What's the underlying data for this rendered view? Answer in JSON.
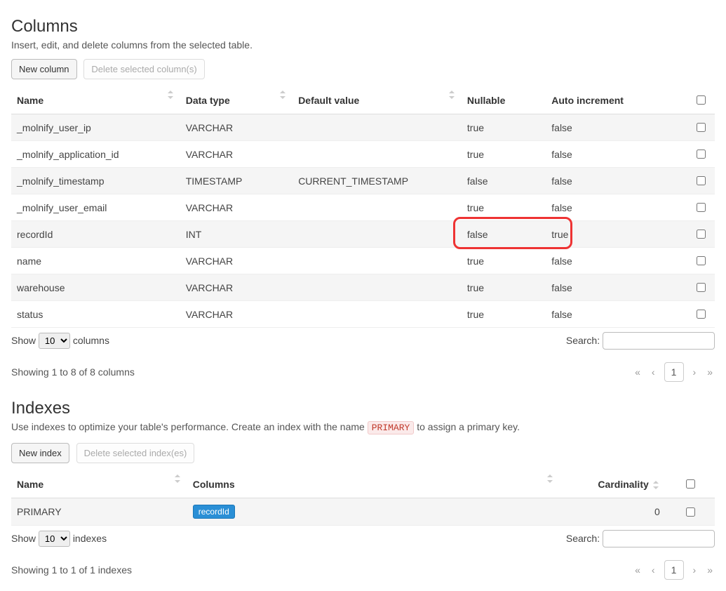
{
  "columnsSection": {
    "title": "Columns",
    "subtitle": "Insert, edit, and delete columns from the selected table.",
    "newBtn": "New column",
    "deleteBtn": "Delete selected column(s)",
    "headers": {
      "name": "Name",
      "dataType": "Data type",
      "defaultValue": "Default value",
      "nullable": "Nullable",
      "autoIncrement": "Auto increment"
    },
    "rows": [
      {
        "name": "_molnify_user_ip",
        "dataType": "VARCHAR",
        "defaultValue": "",
        "nullable": "true",
        "autoIncrement": "false"
      },
      {
        "name": "_molnify_application_id",
        "dataType": "VARCHAR",
        "defaultValue": "",
        "nullable": "true",
        "autoIncrement": "false"
      },
      {
        "name": "_molnify_timestamp",
        "dataType": "TIMESTAMP",
        "defaultValue": "CURRENT_TIMESTAMP",
        "nullable": "false",
        "autoIncrement": "false"
      },
      {
        "name": "_molnify_user_email",
        "dataType": "VARCHAR",
        "defaultValue": "",
        "nullable": "true",
        "autoIncrement": "false"
      },
      {
        "name": "recordId",
        "dataType": "INT",
        "defaultValue": "",
        "nullable": "false",
        "autoIncrement": "true"
      },
      {
        "name": "name",
        "dataType": "VARCHAR",
        "defaultValue": "",
        "nullable": "true",
        "autoIncrement": "false"
      },
      {
        "name": "warehouse",
        "dataType": "VARCHAR",
        "defaultValue": "",
        "nullable": "true",
        "autoIncrement": "false"
      },
      {
        "name": "status",
        "dataType": "VARCHAR",
        "defaultValue": "",
        "nullable": "true",
        "autoIncrement": "false"
      }
    ],
    "showLabel": "Show",
    "showSuffix": "columns",
    "showValue": "10",
    "searchLabel": "Search:",
    "infoText": "Showing 1 to 8 of 8 columns",
    "pager": {
      "first": "«",
      "prev": "‹",
      "page": "1",
      "next": "›",
      "last": "»"
    }
  },
  "indexesSection": {
    "title": "Indexes",
    "subtitlePrefix": "Use indexes to optimize your table's performance. Create an index with the name ",
    "primaryTag": "PRIMARY",
    "subtitleSuffix": " to assign a primary key.",
    "newBtn": "New index",
    "deleteBtn": "Delete selected index(es)",
    "headers": {
      "name": "Name",
      "columns": "Columns",
      "cardinality": "Cardinality"
    },
    "rows": [
      {
        "name": "PRIMARY",
        "colPill": "recordId",
        "cardinality": "0"
      }
    ],
    "showLabel": "Show",
    "showSuffix": "indexes",
    "showValue": "10",
    "searchLabel": "Search:",
    "infoText": "Showing 1 to 1 of 1 indexes",
    "pager": {
      "first": "«",
      "prev": "‹",
      "page": "1",
      "next": "›",
      "last": "»"
    }
  }
}
